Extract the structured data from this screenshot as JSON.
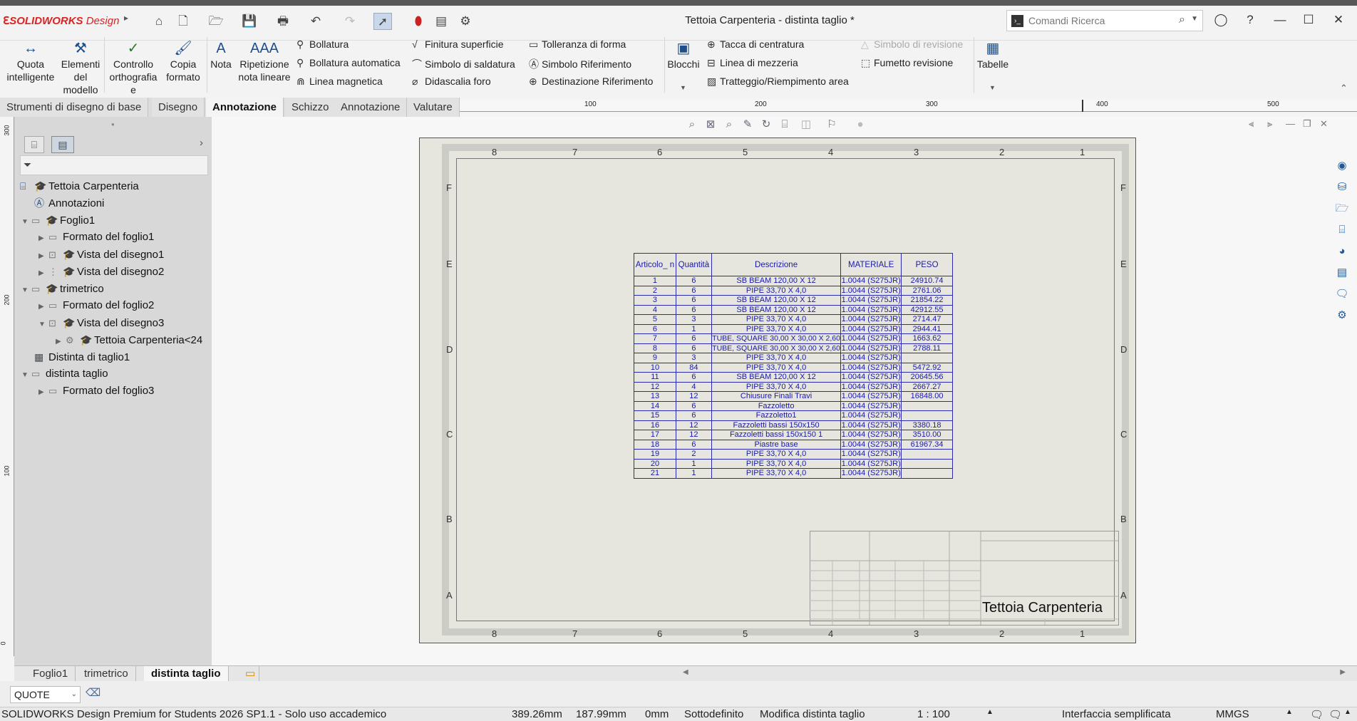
{
  "app": {
    "brand": "SOLIDWORKS",
    "brand_suffix": "Design",
    "title": "Tettoia Carpenteria - distinta taglio *"
  },
  "search": {
    "placeholder": "Comandi Ricerca"
  },
  "ribbon": {
    "quota": "Quota\nintelligente",
    "elementi": "Elementi\ndel\nmodello",
    "controllo": "Controllo\northografia e\ngrammatica",
    "copia": "Copia\nformato",
    "nota": "Nota",
    "ripetizione": "Ripetizione\nnota lineare",
    "bollatura": "Bollatura",
    "bollatura_auto": "Bollatura automatica",
    "linea_magnetica": "Linea magnetica",
    "finitura": "Finitura superficie",
    "saldatura": "Simbolo di saldatura",
    "didascalia": "Didascalia foro",
    "tolleranza": "Tolleranza di forma",
    "simbolo_rif": "Simbolo Riferimento",
    "dest_rif": "Destinazione Riferimento",
    "blocchi": "Blocchi",
    "tacca": "Tacca di centratura",
    "mezzeria": "Linea di mezzeria",
    "tratteggio": "Tratteggio/Riempimento area",
    "revisione": "Simbolo di revisione",
    "fumetto": "Fumetto revisione",
    "tabelle": "Tabelle"
  },
  "tabs": [
    "Strumenti di disegno di base",
    "Disegno",
    "Annotazione",
    "Schizzo",
    "Annotazione",
    "Valutare"
  ],
  "ruler": {
    "h": [
      "100",
      "200",
      "300",
      "400",
      "500"
    ],
    "v": [
      "300",
      "200",
      "100",
      "0"
    ]
  },
  "tree": {
    "root": "Tettoia Carpenteria",
    "annotazioni": "Annotazioni",
    "foglio1": "Foglio1",
    "formato1": "Formato del foglio1",
    "vista1": "Vista del disegno1",
    "vista2": "Vista del disegno2",
    "trimetrico": "trimetrico",
    "formato2": "Formato del foglio2",
    "vista3": "Vista del disegno3",
    "part": "Tettoia Carpenteria<24",
    "distinta1": "Distinta di taglio1",
    "distinta_taglio": "distinta taglio",
    "formato3": "Formato del foglio3"
  },
  "sheet": {
    "cols": [
      "8",
      "7",
      "6",
      "5",
      "4",
      "3",
      "2",
      "1"
    ],
    "rows": [
      "F",
      "E",
      "D",
      "C",
      "B",
      "A"
    ],
    "title": "Tettoia Carpenteria"
  },
  "bom": {
    "headers": [
      "Articolo_ n",
      "Quantità",
      "Descrizione",
      "MATERIALE",
      "PESO"
    ],
    "rows": [
      [
        "1",
        "6",
        "SB BEAM 120,00 X 12",
        "1.0044 (S275JR)",
        "24910.74"
      ],
      [
        "2",
        "6",
        "PIPE 33,70 X 4,0",
        "1.0044 (S275JR)",
        "2761.06"
      ],
      [
        "3",
        "6",
        "SB BEAM 120,00 X 12",
        "1.0044 (S275JR)",
        "21854.22"
      ],
      [
        "4",
        "6",
        "SB BEAM 120,00 X 12",
        "1.0044 (S275JR)",
        "42912.55"
      ],
      [
        "5",
        "3",
        "PIPE 33,70 X 4,0",
        "1.0044 (S275JR)",
        "2714.47"
      ],
      [
        "6",
        "1",
        "PIPE 33,70 X 4,0",
        "1.0044 (S275JR)",
        "2944.41"
      ],
      [
        "7",
        "6",
        "TUBE, SQUARE 30,00 X 30,00 X 2,60",
        "1.0044 (S275JR)",
        "1663.62"
      ],
      [
        "8",
        "6",
        "TUBE, SQUARE 30,00 X 30,00 X 2,60",
        "1.0044 (S275JR)",
        "2788.11"
      ],
      [
        "9",
        "3",
        "PIPE 33,70 X 4,0",
        "1.0044 (S275JR)",
        ""
      ],
      [
        "10",
        "84",
        "PIPE 33,70 X 4,0",
        "1.0044 (S275JR)",
        "5472.92"
      ],
      [
        "11",
        "6",
        "SB BEAM 120,00 X 12",
        "1.0044 (S275JR)",
        "20645.56"
      ],
      [
        "12",
        "4",
        "PIPE 33,70 X 4,0",
        "1.0044 (S275JR)",
        "2667.27"
      ],
      [
        "13",
        "12",
        "Chiusure Finali Travi",
        "1.0044 (S275JR)",
        "16848.00"
      ],
      [
        "14",
        "6",
        "Fazzoletto",
        "1.0044 (S275JR)",
        ""
      ],
      [
        "15",
        "6",
        "Fazzoletto1",
        "1.0044 (S275JR)",
        ""
      ],
      [
        "16",
        "12",
        "Fazzoletti bassi 150x150",
        "1.0044 (S275JR)",
        "3380.18"
      ],
      [
        "17",
        "12",
        "Fazzoletti bassi 150x150 1",
        "1.0044 (S275JR)",
        "3510.00"
      ],
      [
        "18",
        "6",
        "Piastre base",
        "1.0044 (S275JR)",
        "61967.34"
      ],
      [
        "19",
        "2",
        "PIPE 33,70 X 4,0",
        "1.0044 (S275JR)",
        ""
      ],
      [
        "20",
        "1",
        "PIPE 33,70 X 4,0",
        "1.0044 (S275JR)",
        ""
      ],
      [
        "21",
        "1",
        "PIPE 33,70 X 4,0",
        "1.0044 (S275JR)",
        ""
      ]
    ]
  },
  "bottom_tabs": [
    "Foglio1",
    "trimetrico",
    "distinta taglio"
  ],
  "command_select": "QUOTE",
  "status": {
    "product": "SOLIDWORKS Design Premium for Students 2026 SP1.1 - Solo uso accademico",
    "x": "389.26mm",
    "y": "187.99mm",
    "z": "0mm",
    "state": "Sottodefinito",
    "mode": "Modifica distinta taglio",
    "scale": "1 : 100",
    "interface": "Interfaccia semplificata",
    "units": "MMGS"
  },
  "colors": {
    "accent": "#1e4f8c",
    "bom_text": "#1a1aaa",
    "brand_red": "#d22"
  }
}
